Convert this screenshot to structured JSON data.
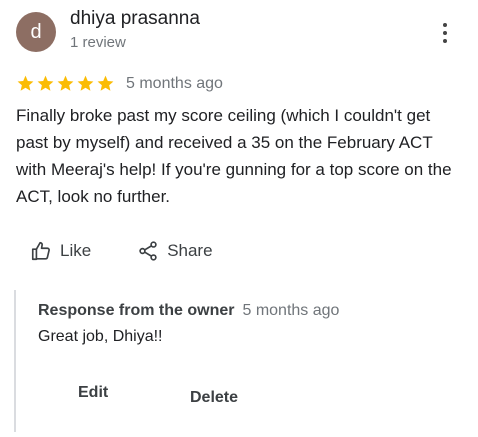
{
  "review": {
    "avatar_letter": "d",
    "avatar_color": "#8d6e63",
    "author": "dhiya prasanna",
    "author_meta": "1 review",
    "rating": 5,
    "star_color": "#fbbc04",
    "time": "5 months ago",
    "text": "Finally broke past my score ceiling (which I couldn't get past by myself) and received a 35 on the February ACT with Meeraj's help! If you're gunning for a top score on the ACT, look no further."
  },
  "actions": {
    "like_label": "Like",
    "share_label": "Share"
  },
  "owner_response": {
    "label": "Response from the owner",
    "time": "5 months ago",
    "text": "Great job, Dhiya!!",
    "edit_label": "Edit",
    "delete_label": "Delete"
  }
}
